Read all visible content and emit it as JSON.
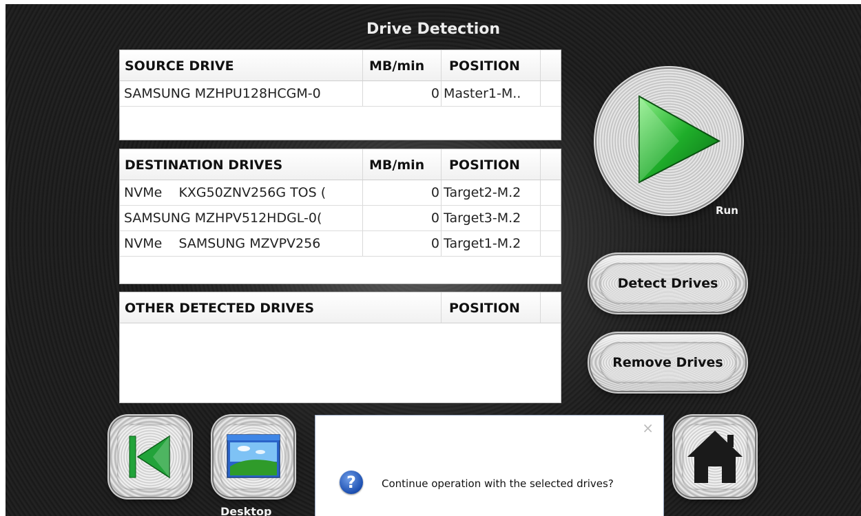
{
  "title": "Drive Detection",
  "source_panel": {
    "header": {
      "name": "SOURCE DRIVE",
      "rate": "MB/min",
      "position": "POSITION"
    },
    "rows": [
      {
        "name": "SAMSUNG MZHPU128HCGM-0",
        "rate": "0",
        "position": "Master1-M.."
      }
    ]
  },
  "destination_panel": {
    "header": {
      "name": "DESTINATION DRIVES",
      "rate": "MB/min",
      "position": "POSITION"
    },
    "rows": [
      {
        "name": "NVMe    KXG50ZNV256G TOS (",
        "rate": "0",
        "position": "Target2-M.2"
      },
      {
        "name": "SAMSUNG MZHPV512HDGL-0(",
        "rate": "0",
        "position": "Target3-M.2"
      },
      {
        "name": "NVMe    SAMSUNG MZVPV256",
        "rate": "0",
        "position": "Target1-M.2"
      }
    ]
  },
  "other_panel": {
    "header": {
      "name": "OTHER DETECTED DRIVES",
      "position": "POSITION"
    },
    "rows": []
  },
  "run_button": {
    "label": "Run"
  },
  "detect_button": {
    "label": "Detect Drives"
  },
  "remove_button": {
    "label": "Remove Drives"
  },
  "desktop_button": {
    "label": "Desktop"
  },
  "dialog": {
    "message": "Continue operation with the selected drives?",
    "close_glyph": "×",
    "icon_glyph": "?"
  },
  "colors": {
    "run_green": "#1fae2a",
    "back_green": "#22a33a"
  }
}
